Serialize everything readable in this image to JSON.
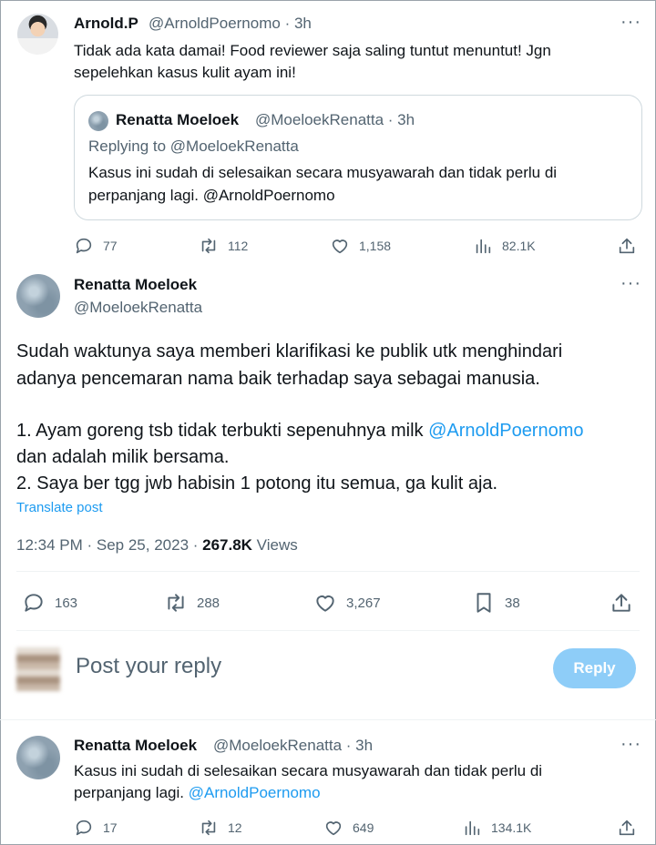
{
  "tweet1": {
    "name": "Arnold.P",
    "handle": "@ArnoldPoernomo",
    "time": "· 3h",
    "more": "···",
    "text1": "Tidak ada kata damai! Food reviewer saja saling tuntut menuntut! Jgn",
    "text2": "sepelehkan kasus kulit ayam ini!",
    "quote": {
      "name": "Renatta Moeloek",
      "handle": "@MoeloekRenatta",
      "time": "· 3h",
      "replying": "Replying to @MoeloekRenatta",
      "text1": "Kasus ini sudah di selesaikan secara musyawarah dan tidak perlu di",
      "text2": "perpanjang lagi. @ArnoldPoernomo"
    },
    "actions": {
      "replies": "77",
      "retweets": "112",
      "likes": "1,158",
      "views": "82.1K"
    }
  },
  "main": {
    "name": "Renatta Moeloek",
    "handle": "@MoeloekRenatta",
    "more": "···",
    "line1": "Sudah waktunya saya memberi klarifikasi ke publik utk menghindari",
    "line2": "adanya pencemaran nama baik terhadap saya sebagai manusia.",
    "line3_pre": "1. Ayam goreng tsb tidak terbukti sepenuhnya milk ",
    "line3_link": "@ArnoldPoernomo",
    "line4": "dan adalah milik bersama.",
    "line5": "2. Saya ber tgg jwb habisin 1 potong itu semua, ga kulit aja.",
    "translate": "Translate post",
    "timestamp": "12:34 PM · Sep 25, 2023 · ",
    "views_count": "267.8K",
    "views_label": " Views",
    "actions": {
      "replies": "163",
      "retweets": "288",
      "likes": "3,267",
      "bookmarks": "38"
    }
  },
  "reply_box": {
    "placeholder": "Post your reply",
    "button": "Reply"
  },
  "tweet3": {
    "name": "Renatta Moeloek",
    "handle": "@MoeloekRenatta",
    "time": "· 3h",
    "more": "···",
    "text1": "Kasus ini sudah di selesaikan secara musyawarah dan tidak perlu di",
    "text2_pre": "perpanjang lagi. ",
    "text2_link": "@ArnoldPoernomo",
    "actions": {
      "replies": "17",
      "retweets": "12",
      "likes": "649",
      "views": "134.1K"
    }
  }
}
